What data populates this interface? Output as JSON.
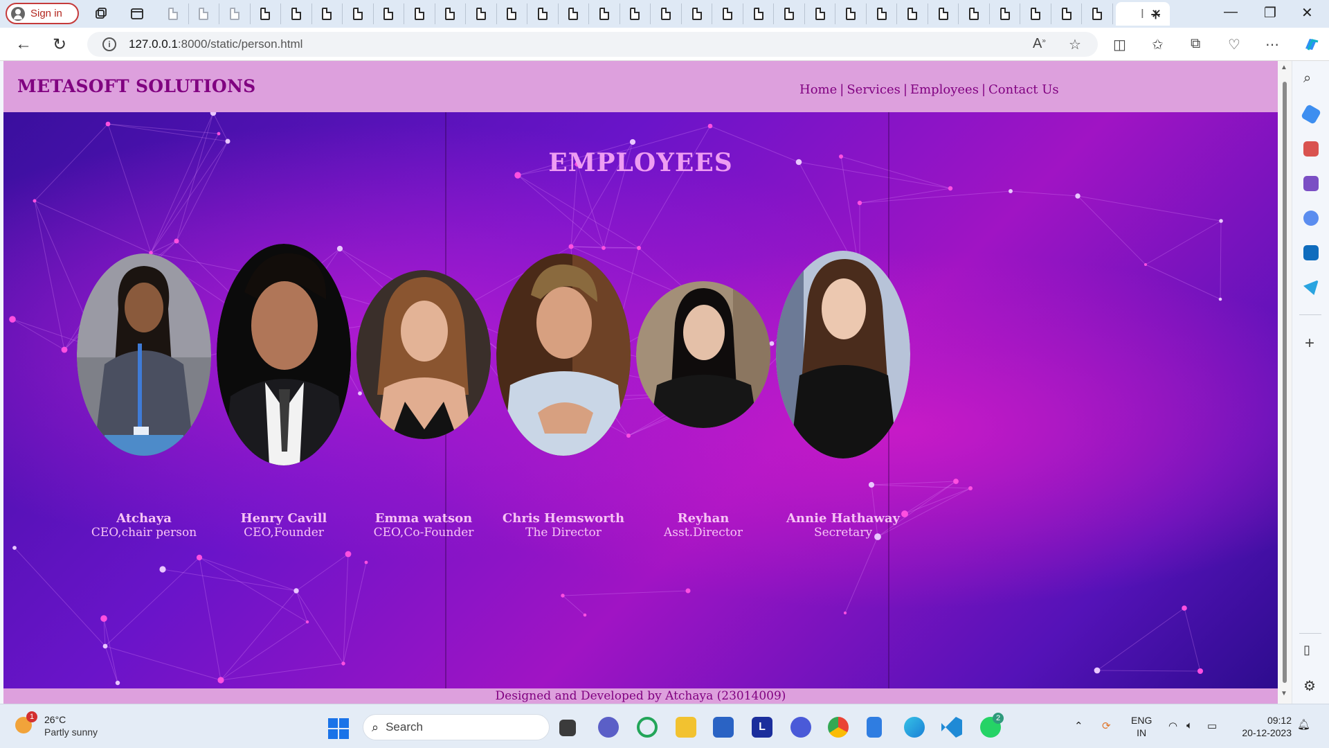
{
  "browser": {
    "signin_label": "Sign in",
    "url_host": "127.0.0.1",
    "url_path": ":8000/static/person.html",
    "active_tab_label": "I",
    "tab_count_visible": 31
  },
  "site": {
    "title": "METASOFT SOLUTIONS",
    "nav": [
      "Home",
      "Services",
      "Employees",
      "Contact Us"
    ],
    "nav_separator": "|",
    "heading": "EMPLOYEES",
    "footer": "Designed and Developed by Atchaya (23014009)",
    "colors": {
      "header_bg": "#dda0dd",
      "header_text": "#800080",
      "heading_text": "#ee9df2",
      "card_text": "#f7c4f5"
    }
  },
  "employees": [
    {
      "name": "Atchaya",
      "role": "CEO,chair person"
    },
    {
      "name": "Henry Cavill",
      "role": "CEO,Founder"
    },
    {
      "name": "Emma watson",
      "role": "CEO,Co-Founder"
    },
    {
      "name": "Chris Hemsworth",
      "role": "The Director"
    },
    {
      "name": "Reyhan",
      "role": "Asst.Director"
    },
    {
      "name": "Annie Hathaway",
      "role": "Secretary"
    }
  ],
  "taskbar": {
    "weather_temp": "26°C",
    "weather_text": "Partly sunny",
    "weather_badge": "1",
    "search_placeholder": "Search",
    "whatsapp_badge": "2",
    "lang_top": "ENG",
    "lang_bottom": "IN",
    "time": "09:12",
    "date": "20-12-2023"
  }
}
